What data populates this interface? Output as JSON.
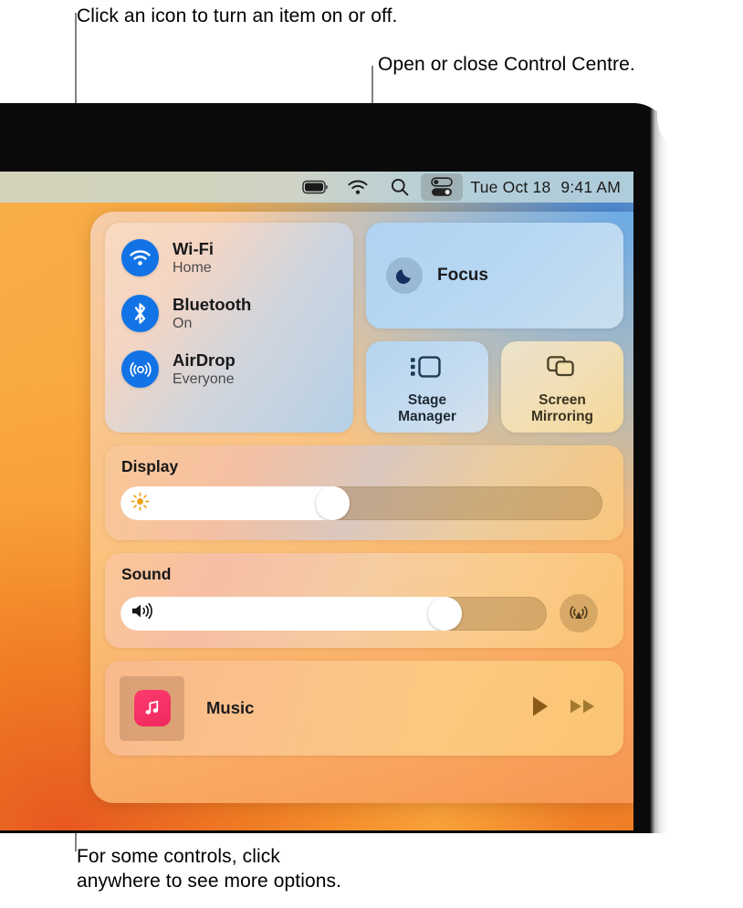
{
  "callouts": {
    "top_left": "Click an icon to turn an item on or off.",
    "top_right": "Open or close Control Centre.",
    "bottom": "For some controls, click\nanywhere to see more options."
  },
  "menu_bar": {
    "icons": [
      {
        "name": "battery-icon",
        "label": "Battery"
      },
      {
        "name": "wifi-icon",
        "label": "Wi-Fi"
      },
      {
        "name": "search-icon",
        "label": "Spotlight Search"
      },
      {
        "name": "control-centre-icon",
        "label": "Control Centre"
      }
    ],
    "date": "Tue Oct 18",
    "time": "9:41 AM"
  },
  "control_centre": {
    "connectivity": [
      {
        "icon": "wifi-icon",
        "title": "Wi-Fi",
        "status": "Home"
      },
      {
        "icon": "bluetooth-icon",
        "title": "Bluetooth",
        "status": "On"
      },
      {
        "icon": "airdrop-icon",
        "title": "AirDrop",
        "status": "Everyone"
      }
    ],
    "focus": {
      "icon": "moon-icon",
      "label": "Focus"
    },
    "tiles": [
      {
        "icon": "stage-manager-icon",
        "label": "Stage\nManager"
      },
      {
        "icon": "screen-mirroring-icon",
        "label": "Screen\nMirroring"
      }
    ],
    "display": {
      "title": "Display",
      "icon": "brightness-icon",
      "value": 46
    },
    "sound": {
      "title": "Sound",
      "icon": "speaker-icon",
      "value": 80,
      "output_icon": "airplay-audio-icon"
    },
    "music": {
      "label": "Music",
      "app_icon": "music-app-icon",
      "controls": [
        {
          "name": "play-button",
          "label": "Play"
        },
        {
          "name": "fast-forward-button",
          "label": "Fast Forward"
        }
      ]
    }
  },
  "colors": {
    "accent_blue": "#1273e6",
    "music_pink": "#f0295f",
    "leader_line": "#7d8285"
  }
}
